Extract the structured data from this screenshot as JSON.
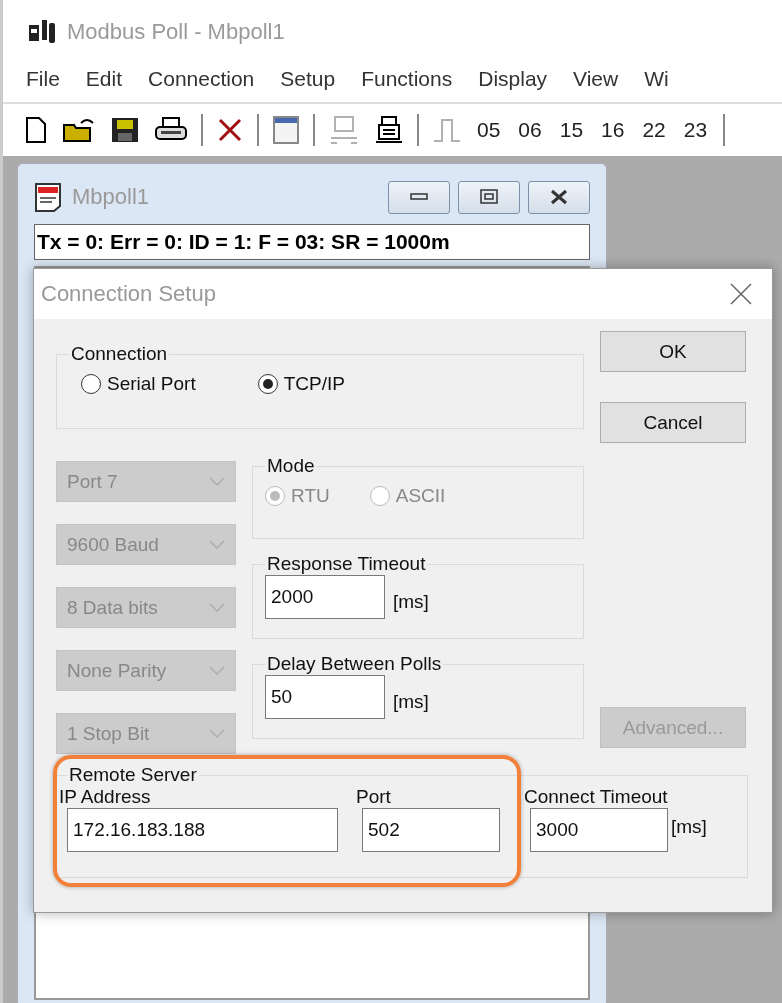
{
  "app": {
    "title": "Modbus Poll - Mbpoll1"
  },
  "menu": [
    {
      "label": "File"
    },
    {
      "label": "Edit"
    },
    {
      "label": "Connection"
    },
    {
      "label": "Setup"
    },
    {
      "label": "Functions"
    },
    {
      "label": "Display"
    },
    {
      "label": "View"
    },
    {
      "label": "Wi"
    }
  ],
  "toolbar": {
    "icons": [
      {
        "kind": "new",
        "disabled": false
      },
      {
        "kind": "open",
        "disabled": false
      },
      {
        "kind": "save",
        "disabled": false
      },
      {
        "kind": "print",
        "disabled": false
      },
      {
        "kind": "separator"
      },
      {
        "kind": "delete",
        "disabled": false
      },
      {
        "kind": "separator"
      },
      {
        "kind": "window",
        "disabled": false
      },
      {
        "kind": "separator"
      },
      {
        "kind": "disconnect",
        "disabled": true
      },
      {
        "kind": "connect",
        "disabled": false
      },
      {
        "kind": "separator"
      },
      {
        "kind": "pulse",
        "disabled": true
      }
    ],
    "function_codes": [
      "05",
      "06",
      "15",
      "16",
      "22",
      "23"
    ]
  },
  "child_window": {
    "title": "Mbpoll1",
    "status": "Tx = 0: Err = 0: ID = 1: F = 03: SR = 1000m"
  },
  "dialog": {
    "title": "Connection Setup",
    "connection": {
      "label": "Connection",
      "options": [
        {
          "label": "Serial Port",
          "selected": false
        },
        {
          "label": "TCP/IP",
          "selected": true
        }
      ]
    },
    "buttons": [
      {
        "label": "OK",
        "disabled": false
      },
      {
        "label": "Cancel",
        "disabled": false
      }
    ],
    "serial_settings": [
      {
        "value": "Port 7",
        "disabled": true
      },
      {
        "value": "9600 Baud",
        "disabled": true
      },
      {
        "value": "8 Data bits",
        "disabled": true
      },
      {
        "value": "None Parity",
        "disabled": true
      },
      {
        "value": "1 Stop Bit",
        "disabled": true
      }
    ],
    "mode": {
      "label": "Mode",
      "disabled": true,
      "options": [
        {
          "label": "RTU",
          "selected": true
        },
        {
          "label": "ASCII",
          "selected": false
        }
      ]
    },
    "response_timeout": {
      "label": "Response Timeout",
      "value": "2000",
      "unit": "[ms]"
    },
    "delay": {
      "label": "Delay Between Polls",
      "value": "50",
      "unit": "[ms]"
    },
    "advanced": {
      "label": "Advanced...",
      "disabled": true
    },
    "remote_server": {
      "label": "Remote Server",
      "highlighted": true,
      "ip": {
        "label": "IP Address",
        "value": "172.16.183.188"
      },
      "port": {
        "label": "Port",
        "value": "502"
      },
      "connect_timeout": {
        "label": "Connect Timeout",
        "value": "3000",
        "unit": "[ms]"
      }
    }
  }
}
